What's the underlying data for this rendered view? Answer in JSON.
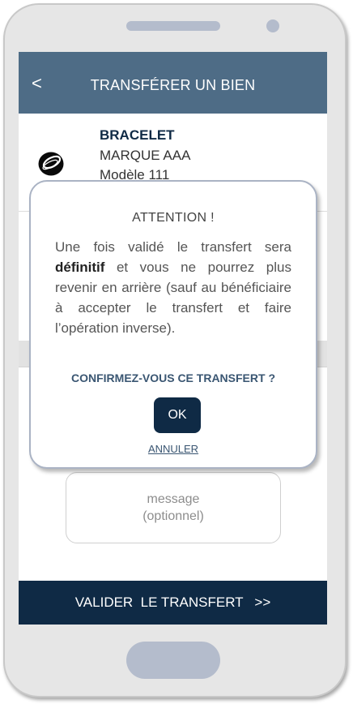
{
  "header": {
    "back_label": "<",
    "title": "TRANSFÉRER UN BIEN"
  },
  "item": {
    "icon": "bracelet-icon",
    "name": "BRACELET",
    "brand": "MARQUE AAA",
    "model": "Modèle 111"
  },
  "message": {
    "placeholder_line1": "message",
    "placeholder_line2": "(optionnel)"
  },
  "footer": {
    "validate_label": "VALIDER  LE TRANSFERT   >>"
  },
  "dialog": {
    "title": "ATTENTION !",
    "body_part1": "Une fois validé le transfert sera",
    "body_bold": "définitif",
    "body_part2": "et vous ne pourrez plus revenir en arrière (sauf au bénéficiaire à accepter le transfert et faire l’opération inverse).",
    "question": "CONFIRMEZ-VOUS CE TRANSFERT ?",
    "ok_label": "OK",
    "cancel_label": "ANNULER"
  },
  "colors": {
    "header": "#4e6c86",
    "footer": "#0f2a45",
    "button": "#0f2a45",
    "phone_body": "#e6e6e6"
  }
}
